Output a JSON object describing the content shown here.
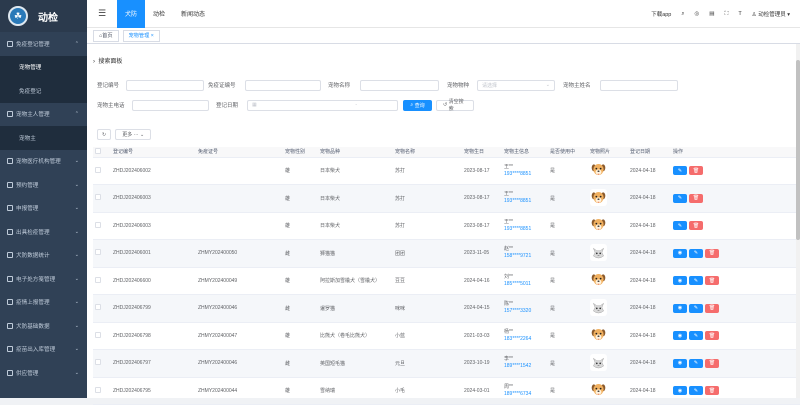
{
  "app": {
    "title": "动检",
    "logo_glyph": "☘"
  },
  "sidebar": {
    "items": [
      {
        "label": "免疫登记管理",
        "icon": "grid-icon",
        "expanded": true
      },
      {
        "label": "宠物管理",
        "sub": true,
        "active": true
      },
      {
        "label": "免疫登记",
        "sub": true
      },
      {
        "label": "宠物主人管理",
        "icon": "user-icon",
        "expanded": true
      },
      {
        "label": "宠物主",
        "sub": true
      },
      {
        "label": "宠物医疗机构管理",
        "icon": "hospital-icon"
      },
      {
        "label": "预约管理",
        "icon": "calendar-icon"
      },
      {
        "label": "申报管理",
        "icon": "doc-icon"
      },
      {
        "label": "出具检疫管理",
        "icon": "check-icon"
      },
      {
        "label": "犬防数据统计",
        "icon": "chart-icon"
      },
      {
        "label": "电子处方笺管理",
        "icon": "prescription-icon"
      },
      {
        "label": "疫情上报管理",
        "icon": "alert-icon"
      },
      {
        "label": "犬防基础数据",
        "icon": "database-icon"
      },
      {
        "label": "疫苗出入库管理",
        "icon": "box-icon"
      },
      {
        "label": "供应管理",
        "icon": "supply-icon"
      }
    ]
  },
  "topbar": {
    "tabs": [
      "犬防",
      "动检",
      "新闻动态"
    ],
    "active_tab": 0,
    "download_label": "下载app",
    "user_label": "动检管理员"
  },
  "tags": {
    "home": "首页",
    "current": "宠物管理"
  },
  "search": {
    "header": "搜索面板",
    "fields": {
      "reg_no": {
        "label": "登记编号",
        "value": ""
      },
      "cert_no": {
        "label": "免疫证编号",
        "value": ""
      },
      "pet_name": {
        "label": "宠物名称",
        "value": ""
      },
      "breed": {
        "label": "宠物物种",
        "placeholder": "请选择"
      },
      "owner_name": {
        "label": "宠物主姓名",
        "value": ""
      },
      "owner_phone": {
        "label": "宠物主电话",
        "value": ""
      },
      "reg_date": {
        "label": "登记日期",
        "start_placeholder": "",
        "end_placeholder": ""
      }
    },
    "search_btn": "查询",
    "reset_btn": "清空搜索"
  },
  "toolbar": {
    "refresh": "↻",
    "more": "更多 ···"
  },
  "table": {
    "headers": [
      "",
      "登记编号",
      "免疫证号",
      "宠物性别",
      "宠物品种",
      "宠物名称",
      "宠物生日",
      "宠物主信息",
      "是否使用中",
      "宠物照片",
      "登记日期",
      "操作"
    ],
    "rows": [
      {
        "reg": "ZHDJ202406002",
        "cert": "",
        "sex": "雄",
        "breed": "日本柴犬",
        "name": "苏打",
        "birthday": "2023-08-17",
        "owner": "王**",
        "phone": "193****8851",
        "active": "是",
        "photo": "dog",
        "date": "2024-04-18",
        "actions": 2
      },
      {
        "reg": "ZHDJ202406003",
        "cert": "",
        "sex": "雄",
        "breed": "日本柴犬",
        "name": "苏打",
        "birthday": "2023-08-17",
        "owner": "王**",
        "phone": "193****8851",
        "active": "是",
        "photo": "dog",
        "date": "2024-04-18",
        "actions": 2
      },
      {
        "reg": "ZHDJ202406003",
        "cert": "",
        "sex": "雄",
        "breed": "日本柴犬",
        "name": "苏打",
        "birthday": "2023-08-17",
        "owner": "王**",
        "phone": "193****8851",
        "active": "是",
        "photo": "dog",
        "date": "2024-04-18",
        "actions": 2
      },
      {
        "reg": "ZHDJ202406001",
        "cert": "ZHMY202400050",
        "sex": "雌",
        "breed": "狮猫猫",
        "name": "团团",
        "birthday": "2023-11-05",
        "owner": "赵**",
        "phone": "158****9721",
        "active": "是",
        "photo": "cat",
        "date": "2024-04-18",
        "actions": 3
      },
      {
        "reg": "ZHDJ202406600",
        "cert": "ZHMY202400049",
        "sex": "雄",
        "breed": "阿拉斯加雪橇犬（雪橇犬）",
        "name": "豆豆",
        "birthday": "2024-04-16",
        "owner": "刘**",
        "phone": "185****5011",
        "active": "是",
        "photo": "dog",
        "date": "2024-04-18",
        "actions": 3
      },
      {
        "reg": "ZHDJ202406799",
        "cert": "ZHMY202400046",
        "sex": "雌",
        "breed": "暹罗猫",
        "name": "咪咪",
        "birthday": "2024-04-15",
        "owner": "陈**",
        "phone": "157****3320",
        "active": "是",
        "photo": "cat",
        "date": "2024-04-18",
        "actions": 3
      },
      {
        "reg": "ZHDJ202406798",
        "cert": "ZHMY202400047",
        "sex": "雄",
        "breed": "比熊犬（卷毛比熊犬）",
        "name": "小蓝",
        "birthday": "2021-03-03",
        "owner": "杨**",
        "phone": "183****2264",
        "active": "是",
        "photo": "dog",
        "date": "2024-04-18",
        "actions": 3
      },
      {
        "reg": "ZHDJ202406797",
        "cert": "ZHMY202400046",
        "sex": "雌",
        "breed": "英国短毛猫",
        "name": "元旦",
        "birthday": "2023-10-19",
        "owner": "李**",
        "phone": "189****1542",
        "active": "是",
        "photo": "cat",
        "date": "2024-04-18",
        "actions": 3
      },
      {
        "reg": "ZHDJ202406795",
        "cert": "ZHMY202400044",
        "sex": "雄",
        "breed": "雪纳瑞",
        "name": "小毛",
        "birthday": "2024-03-01",
        "owner": "周**",
        "phone": "189****6734",
        "active": "是",
        "photo": "dog",
        "date": "2024-04-18",
        "actions": 3
      }
    ]
  },
  "colors": {
    "primary": "#1890ff",
    "danger": "#f56c6c",
    "sidebar_bg": "#304156"
  }
}
